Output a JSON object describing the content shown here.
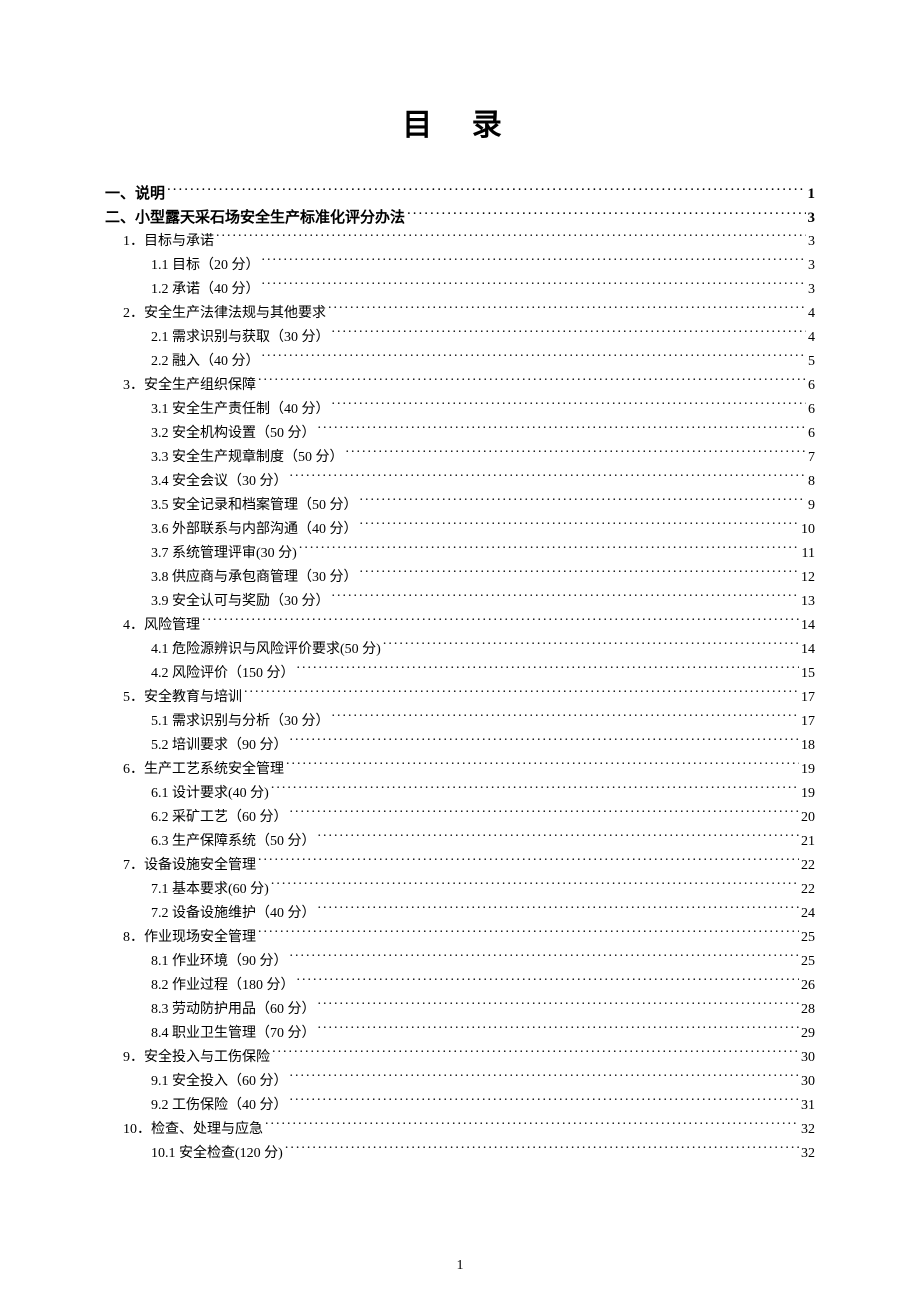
{
  "title": "目 录",
  "page_number": "1",
  "toc": [
    {
      "level": 1,
      "label": "一、说明",
      "page": "1"
    },
    {
      "level": 1,
      "label": "二、小型露天采石场安全生产标准化评分办法",
      "page": "3"
    },
    {
      "level": 2,
      "label": "1．目标与承诺",
      "page": "3"
    },
    {
      "level": 3,
      "label": "1.1 目标（20 分）",
      "page": "3"
    },
    {
      "level": 3,
      "label": "1.2 承诺（40 分）",
      "page": "3"
    },
    {
      "level": 2,
      "label": "2．安全生产法律法规与其他要求",
      "page": "4"
    },
    {
      "level": 3,
      "label": "2.1 需求识别与获取（30 分）",
      "page": "4"
    },
    {
      "level": 3,
      "label": "2.2 融入（40 分）",
      "page": "5"
    },
    {
      "level": 2,
      "label": "3．安全生产组织保障",
      "page": "6"
    },
    {
      "level": 3,
      "label": "3.1 安全生产责任制（40 分）",
      "page": "6"
    },
    {
      "level": 3,
      "label": "3.2 安全机构设置（50 分）",
      "page": "6"
    },
    {
      "level": 3,
      "label": "3.3 安全生产规章制度（50 分）",
      "page": "7"
    },
    {
      "level": 3,
      "label": "3.4 安全会议（30 分）",
      "page": "8"
    },
    {
      "level": 3,
      "label": "3.5 安全记录和档案管理（50 分）",
      "page": "9"
    },
    {
      "level": 3,
      "label": "3.6 外部联系与内部沟通（40 分）",
      "page": "10"
    },
    {
      "level": 3,
      "label": "3.7 系统管理评审(30 分)",
      "page": "11"
    },
    {
      "level": 3,
      "label": "3.8 供应商与承包商管理（30 分）",
      "page": "12"
    },
    {
      "level": 3,
      "label": "3.9 安全认可与奖励（30 分）",
      "page": "13"
    },
    {
      "level": 2,
      "label": "4．风险管理",
      "page": "14"
    },
    {
      "level": 3,
      "label": "4.1 危险源辨识与风险评价要求(50 分)",
      "page": "14"
    },
    {
      "level": 3,
      "label": "4.2 风险评价（150 分）",
      "page": "15"
    },
    {
      "level": 2,
      "label": "5．安全教育与培训",
      "page": "17"
    },
    {
      "level": 3,
      "label": "5.1 需求识别与分析（30 分）",
      "page": "17"
    },
    {
      "level": 3,
      "label": "5.2 培训要求（90 分）",
      "page": "18"
    },
    {
      "level": 2,
      "label": "6．生产工艺系统安全管理",
      "page": "19"
    },
    {
      "level": 3,
      "label": "6.1 设计要求(40 分)",
      "page": "19"
    },
    {
      "level": 3,
      "label": "6.2 采矿工艺（60 分）",
      "page": "20"
    },
    {
      "level": 3,
      "label": "6.3 生产保障系统（50 分）",
      "page": "21"
    },
    {
      "level": 2,
      "label": "7．设备设施安全管理",
      "page": "22"
    },
    {
      "level": 3,
      "label": "7.1 基本要求(60 分)",
      "page": "22"
    },
    {
      "level": 3,
      "label": "7.2 设备设施维护（40 分）",
      "page": "24"
    },
    {
      "level": 2,
      "label": "8．作业现场安全管理",
      "page": "25"
    },
    {
      "level": 3,
      "label": "8.1 作业环境（90 分）",
      "page": "25"
    },
    {
      "level": 3,
      "label": "8.2 作业过程（180 分）",
      "page": "26"
    },
    {
      "level": 3,
      "label": "8.3 劳动防护用品（60 分）",
      "page": "28"
    },
    {
      "level": 3,
      "label": "8.4 职业卫生管理（70 分）",
      "page": "29"
    },
    {
      "level": 2,
      "label": "9．安全投入与工伤保险",
      "page": "30"
    },
    {
      "level": 3,
      "label": "9.1 安全投入（60 分）",
      "page": "30"
    },
    {
      "level": 3,
      "label": "9.2 工伤保险（40 分）",
      "page": "31"
    },
    {
      "level": 2,
      "label": "10．检查、处理与应急",
      "page": "32"
    },
    {
      "level": 3,
      "label": "10.1  安全检查(120 分)",
      "page": "32"
    }
  ]
}
